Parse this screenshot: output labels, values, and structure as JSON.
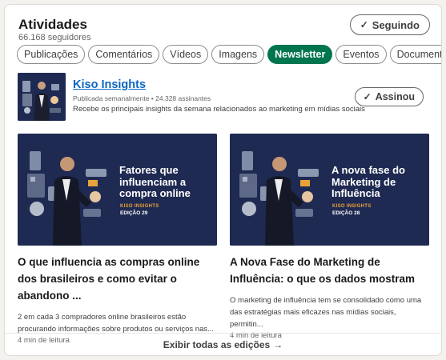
{
  "header": {
    "title": "Atividades",
    "followers": "66.168 seguidores",
    "follow_button": "Seguindo"
  },
  "tabs": [
    "Publicações",
    "Comentários",
    "Vídeos",
    "Imagens",
    "Newsletter",
    "Eventos",
    "Documentos"
  ],
  "active_tab": "Newsletter",
  "newsletter": {
    "name": "Kiso Insights",
    "meta": "Publicada semanalmente • 24.328 assinantes",
    "description": "Recebe os principais insights da semana relacionados ao marketing em mídias sociais",
    "subscribe_button": "Assinou"
  },
  "articles": [
    {
      "image_headline_1": "Fatores que",
      "image_headline_2": "influenciam a",
      "image_headline_3": "compra online",
      "image_brand": "KISO INSIGHTS",
      "image_edition": "EDIÇÃO 29",
      "title": "O que influencia as compras online dos brasileiros e como evitar o abandono ...",
      "description": "2 em cada 3 compradores online brasileiros estão procurando informações sobre produtos ou serviços nas...",
      "read_time": "4 min de leitura"
    },
    {
      "image_headline_1": "A nova fase do",
      "image_headline_2": "Marketing de",
      "image_headline_3": "Influência",
      "image_brand": "KISO INSIGHTS",
      "image_edition": "EDIÇÃO 28",
      "title": "A Nova Fase do Marketing de Influência: o que os dados mostram",
      "description": "O marketing de influência tem se consolidado como uma das estratégias mais eficazes nas mídias sociais, permitin...",
      "read_time": "4 min de leitura"
    }
  ],
  "footer": {
    "label": "Exibir todas as edições",
    "arrow": "→"
  },
  "colors": {
    "accent_green": "#01754f",
    "link_blue": "#0a66c2",
    "image_navy": "#1f2a52",
    "brand_orange": "#e9a23b"
  },
  "icons": {
    "check": "✓"
  }
}
